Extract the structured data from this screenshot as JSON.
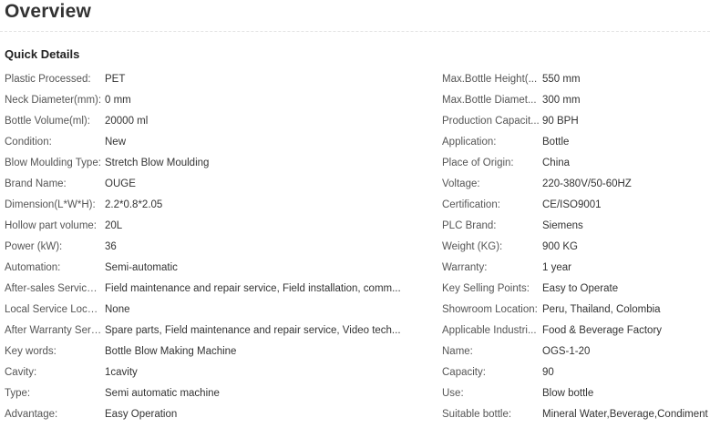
{
  "header": {
    "title": "Overview"
  },
  "section": {
    "title": "Quick Details"
  },
  "left_details": [
    {
      "label": "Plastic Processed:",
      "value": "PET"
    },
    {
      "label": "Neck Diameter(mm):",
      "value": "0 mm"
    },
    {
      "label": "Bottle Volume(ml):",
      "value": "20000 ml"
    },
    {
      "label": "Condition:",
      "value": "New"
    },
    {
      "label": "Blow Moulding Type:",
      "value": "Stretch Blow Moulding"
    },
    {
      "label": "Brand Name:",
      "value": "OUGE"
    },
    {
      "label": "Dimension(L*W*H):",
      "value": "2.2*0.8*2.05"
    },
    {
      "label": "Hollow part volume:",
      "value": "20L"
    },
    {
      "label": "Power (kW):",
      "value": "36"
    },
    {
      "label": "Automation:",
      "value": "Semi-automatic"
    },
    {
      "label": "After-sales Service ...",
      "value": "Field maintenance and repair service, Field installation, comm..."
    },
    {
      "label": "Local Service Locat...",
      "value": "None"
    },
    {
      "label": "After Warranty Serv...",
      "value": "Spare parts, Field maintenance and repair service, Video tech..."
    },
    {
      "label": "Key words:",
      "value": "Bottle Blow Making Machine"
    },
    {
      "label": "Cavity:",
      "value": "1cavity"
    },
    {
      "label": "Type:",
      "value": "Semi automatic machine"
    },
    {
      "label": "Advantage:",
      "value": "Easy Operation"
    }
  ],
  "right_details": [
    {
      "label": "Max.Bottle Height(...",
      "value": "550 mm"
    },
    {
      "label": "Max.Bottle Diamet...",
      "value": "300 mm"
    },
    {
      "label": "Production Capacit...",
      "value": "90 BPH"
    },
    {
      "label": "Application:",
      "value": "Bottle"
    },
    {
      "label": "Place of Origin:",
      "value": "China"
    },
    {
      "label": "Voltage:",
      "value": "220-380V/50-60HZ"
    },
    {
      "label": "Certification:",
      "value": "CE/ISO9001"
    },
    {
      "label": "PLC Brand:",
      "value": "Siemens"
    },
    {
      "label": "Weight (KG):",
      "value": "900 KG"
    },
    {
      "label": "Warranty:",
      "value": "1 year"
    },
    {
      "label": "Key Selling Points:",
      "value": "Easy to Operate"
    },
    {
      "label": "Showroom Location:",
      "value": "Peru, Thailand, Colombia"
    },
    {
      "label": "Applicable Industri...",
      "value": "Food & Beverage Factory"
    },
    {
      "label": "Name:",
      "value": "OGS-1-20"
    },
    {
      "label": "Capacity:",
      "value": "90"
    },
    {
      "label": "Use:",
      "value": "Blow bottle"
    },
    {
      "label": "Suitable bottle:",
      "value": "Mineral Water,Beverage,Condiment"
    }
  ]
}
